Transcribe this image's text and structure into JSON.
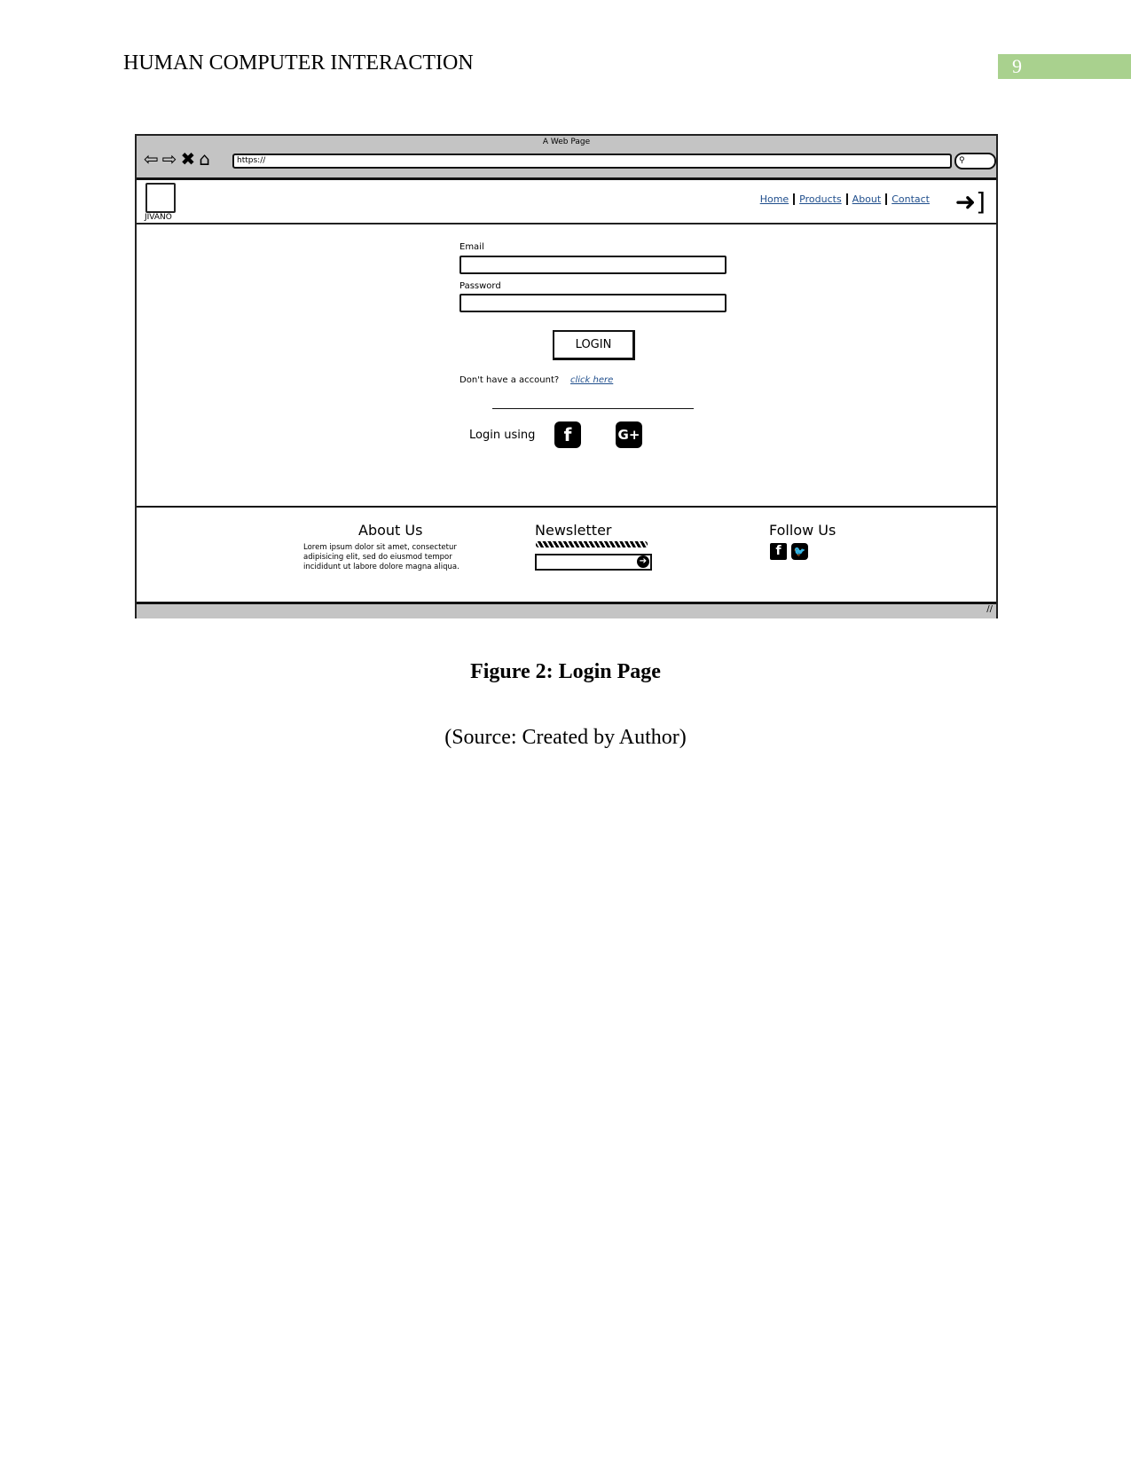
{
  "document": {
    "header": "HUMAN COMPUTER INTERACTION",
    "page_number": "9",
    "figure_caption": "Figure 2: Login Page",
    "source": "(Source: Created by Author)",
    "accent_color": "#a9d18e"
  },
  "browser": {
    "window_title": "A Web Page",
    "url": "https://",
    "icons": [
      "back-arrow-icon",
      "forward-arrow-icon",
      "close-x-icon",
      "home-icon",
      "search-icon"
    ]
  },
  "site": {
    "logo_text": "JIVANO",
    "nav": [
      "Home",
      "Products",
      "About",
      "Contact"
    ],
    "login_form": {
      "email_label": "Email",
      "password_label": "Password",
      "email_value": "",
      "password_value": "",
      "login_button": "LOGIN",
      "no_account_text": "Don't have a account?",
      "signup_link": "click here",
      "social_label": "Login using",
      "social_icons": [
        "facebook-icon",
        "google-plus-icon"
      ]
    },
    "footer": {
      "about_title": "About Us",
      "about_text": "Lorem ipsum dolor sit amet, consectetur adipisicing elit, sed do eiusmod tempor incididunt ut labore dolore magna aliqua.",
      "newsletter_title": "Newsletter",
      "newsletter_input": "",
      "follow_title": "Follow Us",
      "follow_icons": [
        "facebook-icon",
        "twitter-icon"
      ]
    }
  }
}
